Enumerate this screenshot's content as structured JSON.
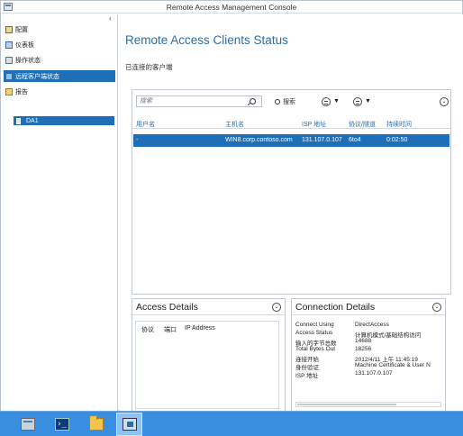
{
  "window": {
    "title": "Remote Access Management Console"
  },
  "sidebar": {
    "collapse_glyph": "‹",
    "items": [
      {
        "label": "配置",
        "icon": "config-icon",
        "active": false
      },
      {
        "label": "仪表板",
        "icon": "dashboard-icon",
        "active": false
      },
      {
        "label": "操作状态",
        "icon": "operations-icon",
        "active": false
      },
      {
        "label": "远程客户端状态",
        "icon": "remote-clients-icon",
        "active": true
      },
      {
        "label": "报告",
        "icon": "reports-icon",
        "active": false
      }
    ],
    "server": {
      "label": "DA1",
      "icon": "server-icon"
    }
  },
  "main": {
    "title": "Remote Access Clients Status",
    "section_label": "已连接的客户端",
    "toolbar": {
      "search_placeholder": "搜索",
      "search_button_label": "搜索",
      "dropdown_arrow": "▼",
      "expand_glyph": "⌄"
    },
    "table": {
      "columns": [
        "用户名",
        "主机名",
        "ISP 地址",
        "协议/隧道",
        "持续时间"
      ],
      "rows": [
        [
          "-",
          "WIN8.corp.contoso.com",
          "131.107.0.107",
          "6to4",
          "0:02:50"
        ]
      ]
    }
  },
  "access_details": {
    "title": "Access Details",
    "toggle_glyph": "⌄",
    "columns": [
      "协议",
      "端口",
      "IP Address"
    ]
  },
  "connection_details": {
    "title": "Connection Details",
    "toggle_glyph": "⌄",
    "rows": [
      {
        "key": "Connect Using",
        "value": "DirectAccess"
      },
      {
        "key": "Access Status",
        "value": "计算机模式/基础结构访问"
      },
      {
        "key": "输入的字节总数",
        "value": "14688"
      },
      {
        "key": "Total Bytes Out",
        "value": "18256"
      },
      {
        "key": "连接开始",
        "value": "2012/4/11 上午 11:45:19"
      },
      {
        "key": "身份验证",
        "value": "Machine Certificate & User N"
      },
      {
        "key": "ISP 地址",
        "value": "131.107.0.107"
      }
    ]
  },
  "taskbar": {
    "items": [
      {
        "icon": "server-manager-icon",
        "active": false
      },
      {
        "icon": "powershell-icon",
        "glyph": "›_",
        "active": false
      },
      {
        "icon": "file-explorer-icon",
        "active": false
      },
      {
        "icon": "remote-access-console-icon",
        "active": true
      }
    ]
  },
  "colors": {
    "accent": "#1e6fb8",
    "title_blue": "#2e6da4",
    "taskbar": "#3a8ee0"
  }
}
